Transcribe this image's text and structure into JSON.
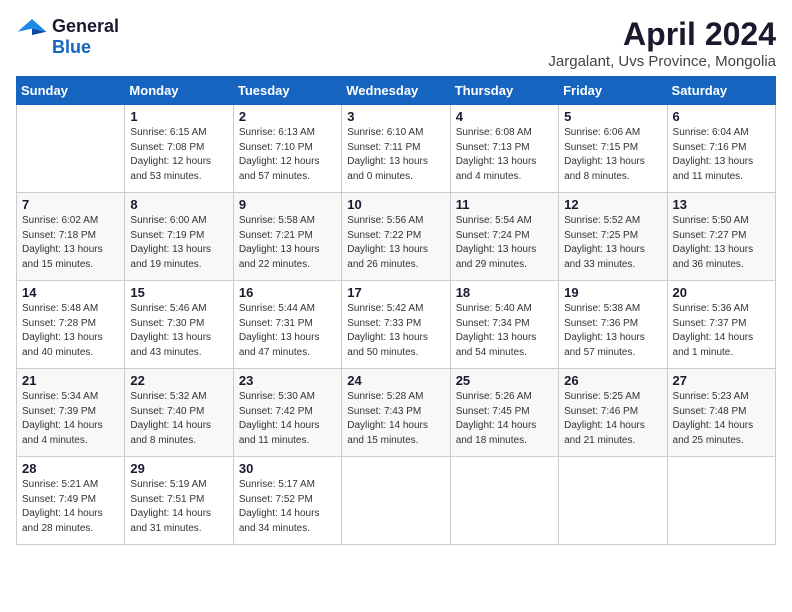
{
  "logo": {
    "general": "General",
    "blue": "Blue"
  },
  "title": "April 2024",
  "location": "Jargalant, Uvs Province, Mongolia",
  "days_header": [
    "Sunday",
    "Monday",
    "Tuesday",
    "Wednesday",
    "Thursday",
    "Friday",
    "Saturday"
  ],
  "weeks": [
    [
      {
        "num": "",
        "info": ""
      },
      {
        "num": "1",
        "info": "Sunrise: 6:15 AM\nSunset: 7:08 PM\nDaylight: 12 hours\nand 53 minutes."
      },
      {
        "num": "2",
        "info": "Sunrise: 6:13 AM\nSunset: 7:10 PM\nDaylight: 12 hours\nand 57 minutes."
      },
      {
        "num": "3",
        "info": "Sunrise: 6:10 AM\nSunset: 7:11 PM\nDaylight: 13 hours\nand 0 minutes."
      },
      {
        "num": "4",
        "info": "Sunrise: 6:08 AM\nSunset: 7:13 PM\nDaylight: 13 hours\nand 4 minutes."
      },
      {
        "num": "5",
        "info": "Sunrise: 6:06 AM\nSunset: 7:15 PM\nDaylight: 13 hours\nand 8 minutes."
      },
      {
        "num": "6",
        "info": "Sunrise: 6:04 AM\nSunset: 7:16 PM\nDaylight: 13 hours\nand 11 minutes."
      }
    ],
    [
      {
        "num": "7",
        "info": "Sunrise: 6:02 AM\nSunset: 7:18 PM\nDaylight: 13 hours\nand 15 minutes."
      },
      {
        "num": "8",
        "info": "Sunrise: 6:00 AM\nSunset: 7:19 PM\nDaylight: 13 hours\nand 19 minutes."
      },
      {
        "num": "9",
        "info": "Sunrise: 5:58 AM\nSunset: 7:21 PM\nDaylight: 13 hours\nand 22 minutes."
      },
      {
        "num": "10",
        "info": "Sunrise: 5:56 AM\nSunset: 7:22 PM\nDaylight: 13 hours\nand 26 minutes."
      },
      {
        "num": "11",
        "info": "Sunrise: 5:54 AM\nSunset: 7:24 PM\nDaylight: 13 hours\nand 29 minutes."
      },
      {
        "num": "12",
        "info": "Sunrise: 5:52 AM\nSunset: 7:25 PM\nDaylight: 13 hours\nand 33 minutes."
      },
      {
        "num": "13",
        "info": "Sunrise: 5:50 AM\nSunset: 7:27 PM\nDaylight: 13 hours\nand 36 minutes."
      }
    ],
    [
      {
        "num": "14",
        "info": "Sunrise: 5:48 AM\nSunset: 7:28 PM\nDaylight: 13 hours\nand 40 minutes."
      },
      {
        "num": "15",
        "info": "Sunrise: 5:46 AM\nSunset: 7:30 PM\nDaylight: 13 hours\nand 43 minutes."
      },
      {
        "num": "16",
        "info": "Sunrise: 5:44 AM\nSunset: 7:31 PM\nDaylight: 13 hours\nand 47 minutes."
      },
      {
        "num": "17",
        "info": "Sunrise: 5:42 AM\nSunset: 7:33 PM\nDaylight: 13 hours\nand 50 minutes."
      },
      {
        "num": "18",
        "info": "Sunrise: 5:40 AM\nSunset: 7:34 PM\nDaylight: 13 hours\nand 54 minutes."
      },
      {
        "num": "19",
        "info": "Sunrise: 5:38 AM\nSunset: 7:36 PM\nDaylight: 13 hours\nand 57 minutes."
      },
      {
        "num": "20",
        "info": "Sunrise: 5:36 AM\nSunset: 7:37 PM\nDaylight: 14 hours\nand 1 minute."
      }
    ],
    [
      {
        "num": "21",
        "info": "Sunrise: 5:34 AM\nSunset: 7:39 PM\nDaylight: 14 hours\nand 4 minutes."
      },
      {
        "num": "22",
        "info": "Sunrise: 5:32 AM\nSunset: 7:40 PM\nDaylight: 14 hours\nand 8 minutes."
      },
      {
        "num": "23",
        "info": "Sunrise: 5:30 AM\nSunset: 7:42 PM\nDaylight: 14 hours\nand 11 minutes."
      },
      {
        "num": "24",
        "info": "Sunrise: 5:28 AM\nSunset: 7:43 PM\nDaylight: 14 hours\nand 15 minutes."
      },
      {
        "num": "25",
        "info": "Sunrise: 5:26 AM\nSunset: 7:45 PM\nDaylight: 14 hours\nand 18 minutes."
      },
      {
        "num": "26",
        "info": "Sunrise: 5:25 AM\nSunset: 7:46 PM\nDaylight: 14 hours\nand 21 minutes."
      },
      {
        "num": "27",
        "info": "Sunrise: 5:23 AM\nSunset: 7:48 PM\nDaylight: 14 hours\nand 25 minutes."
      }
    ],
    [
      {
        "num": "28",
        "info": "Sunrise: 5:21 AM\nSunset: 7:49 PM\nDaylight: 14 hours\nand 28 minutes."
      },
      {
        "num": "29",
        "info": "Sunrise: 5:19 AM\nSunset: 7:51 PM\nDaylight: 14 hours\nand 31 minutes."
      },
      {
        "num": "30",
        "info": "Sunrise: 5:17 AM\nSunset: 7:52 PM\nDaylight: 14 hours\nand 34 minutes."
      },
      {
        "num": "",
        "info": ""
      },
      {
        "num": "",
        "info": ""
      },
      {
        "num": "",
        "info": ""
      },
      {
        "num": "",
        "info": ""
      }
    ]
  ]
}
